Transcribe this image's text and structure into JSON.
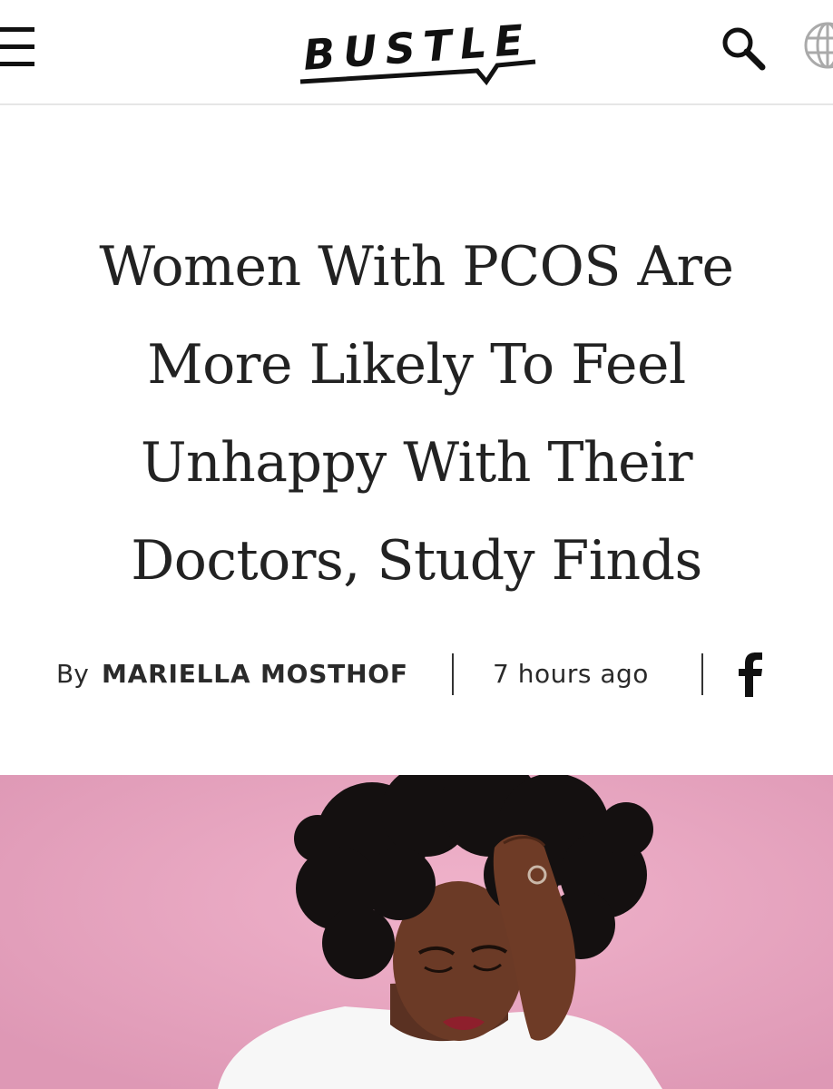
{
  "header": {
    "logo_text": "BUSTLE",
    "icons": {
      "menu": "hamburger-menu-icon",
      "search": "search-icon",
      "globe": "globe-icon"
    }
  },
  "article": {
    "headline_lines": [
      "Women With PCOS Are",
      "More Likely To Feel",
      "Unhappy With Their",
      "Doctors, Study Finds"
    ],
    "byline": {
      "prefix": "By",
      "author": "MARIELLA MOSTHOF",
      "time": "7 hours ago"
    },
    "share": {
      "icon": "facebook-icon"
    }
  },
  "colors": {
    "hero_background": "#e9a8c1",
    "text": "#222222",
    "divider": "#e6e6e6"
  }
}
